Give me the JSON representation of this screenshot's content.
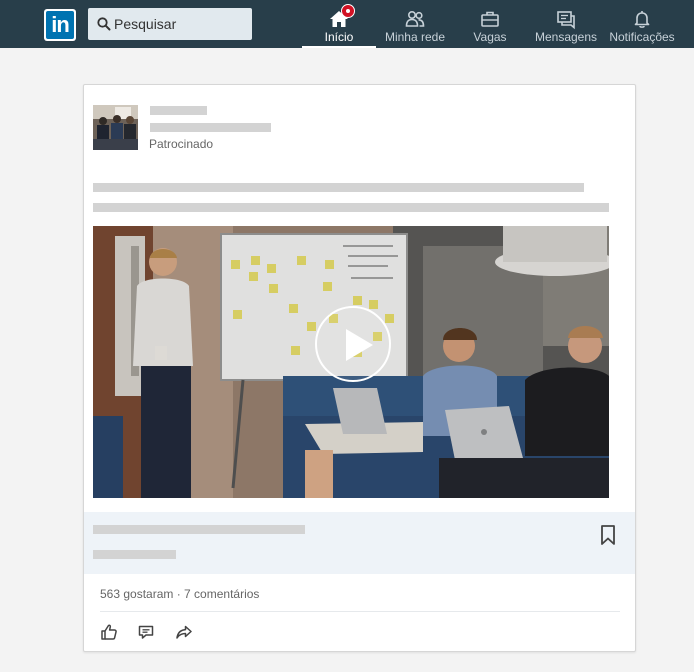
{
  "nav": {
    "logo_text": "in",
    "search": {
      "placeholder": "Pesquisar",
      "value": ""
    },
    "items": [
      {
        "label": "Início",
        "icon": "home-icon",
        "active": true,
        "badge": true
      },
      {
        "label": "Minha rede",
        "icon": "people-icon",
        "active": false
      },
      {
        "label": "Vagas",
        "icon": "briefcase-icon",
        "active": false
      },
      {
        "label": "Mensagens",
        "icon": "messages-icon",
        "active": false
      },
      {
        "label": "Notificações",
        "icon": "bell-icon",
        "active": false
      }
    ]
  },
  "post": {
    "sponsored_label": "Patrocinado",
    "media_type": "video",
    "social_counts": "563 gostaram · 7 comentários",
    "actions": [
      "like-icon",
      "comment-icon",
      "share-icon"
    ]
  },
  "colors": {
    "nav_bg": "#283e4a",
    "brand": "#0073b1",
    "badge": "#d11124",
    "page_bg": "#f3f3f3",
    "placeholder": "#d3d3d3",
    "link_box_bg": "#eef3f8"
  }
}
